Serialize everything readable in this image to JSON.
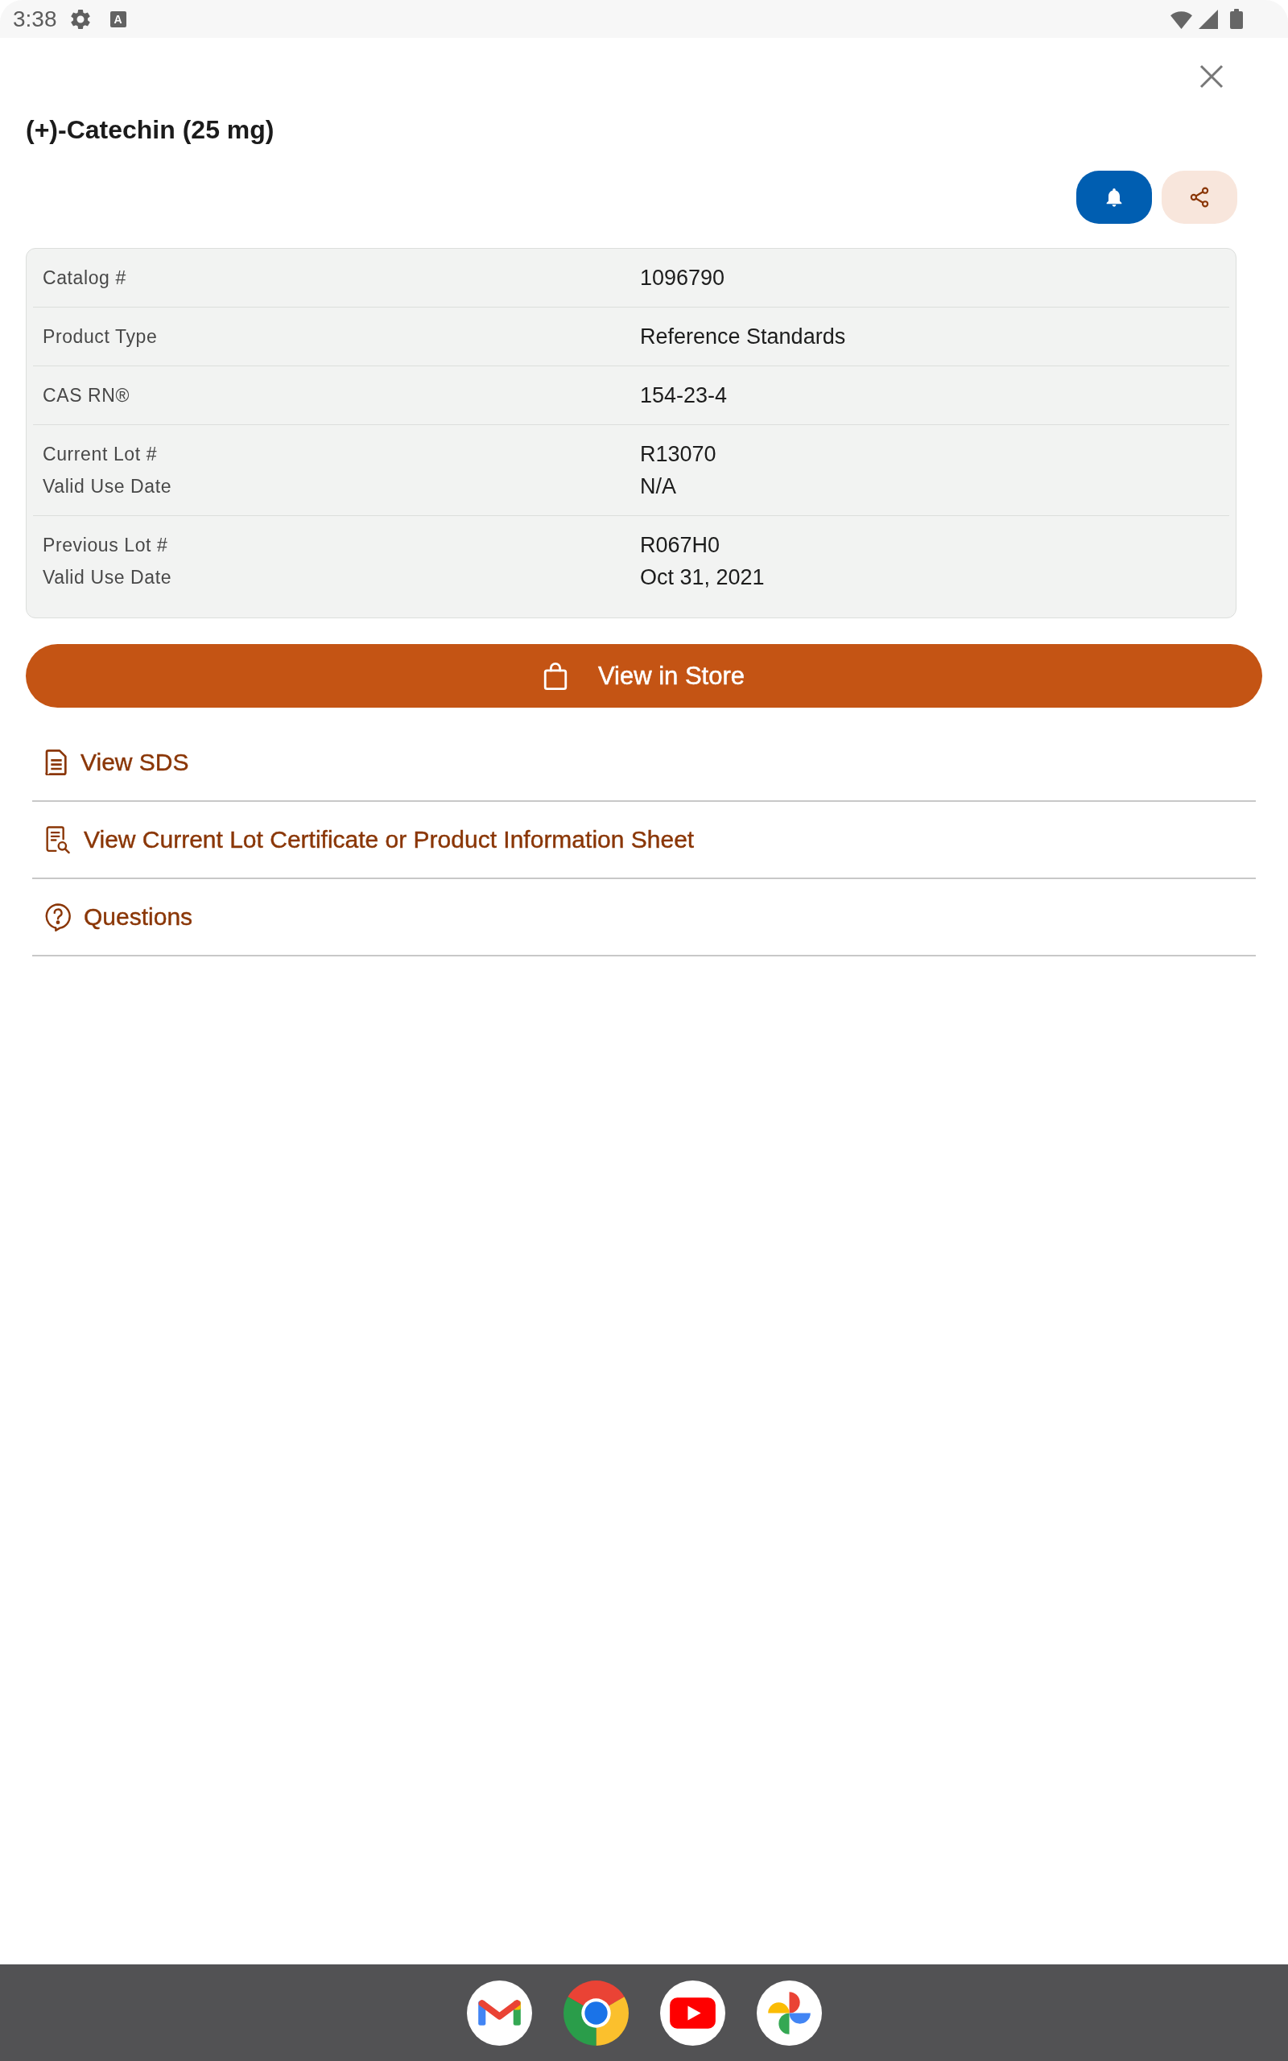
{
  "status_bar": {
    "time": "3:38",
    "notification_glyph": "A"
  },
  "dialog": {
    "title": "(+)-Catechin (25 mg)"
  },
  "details": [
    {
      "labels": [
        "Catalog #"
      ],
      "values": [
        "1096790"
      ]
    },
    {
      "labels": [
        "Product Type"
      ],
      "values": [
        "Reference Standards"
      ]
    },
    {
      "labels": [
        "CAS RN®"
      ],
      "values": [
        "154-23-4"
      ]
    },
    {
      "labels": [
        "Current Lot #",
        "Valid Use Date"
      ],
      "values": [
        "R13070",
        "N/A"
      ]
    },
    {
      "labels": [
        "Previous Lot #",
        "Valid Use Date"
      ],
      "values": [
        "R067H0",
        "Oct 31, 2021"
      ]
    }
  ],
  "store_button": {
    "label": "View in Store"
  },
  "links": [
    {
      "label": "View SDS"
    },
    {
      "label": "View Current Lot Certificate or Product Information Sheet"
    },
    {
      "label": "Questions"
    }
  ]
}
